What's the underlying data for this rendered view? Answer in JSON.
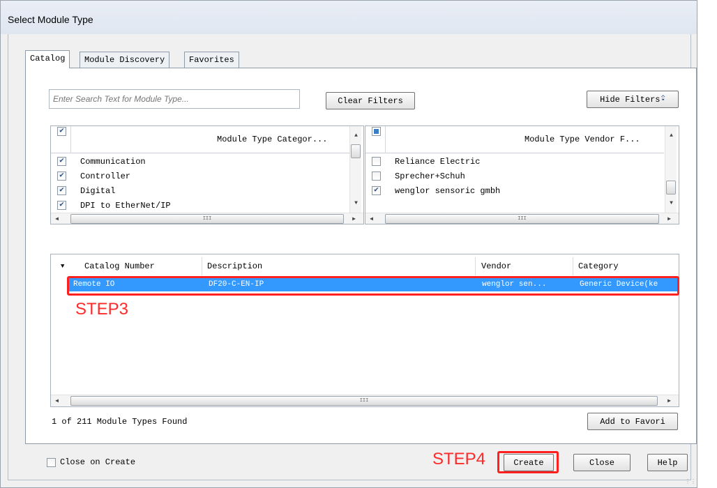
{
  "window": {
    "title": "Select Module Type"
  },
  "tabs": [
    {
      "label": "Catalog",
      "active": true
    },
    {
      "label": "Module Discovery",
      "active": false
    },
    {
      "label": "Favorites",
      "active": false
    }
  ],
  "search": {
    "placeholder": "Enter Search Text for Module Type..."
  },
  "buttons": {
    "clear_filters": "Clear Filters",
    "hide_filters": "Hide Filters",
    "add_to_favorites": "Add to Favori",
    "create": "Create",
    "close": "Close",
    "help": "Help"
  },
  "category_filter": {
    "header": "Module Type Categor...",
    "all_checked": true,
    "items": [
      {
        "label": "Communication",
        "checked": true
      },
      {
        "label": "Controller",
        "checked": true
      },
      {
        "label": "Digital",
        "checked": true
      },
      {
        "label": "DPI to EtherNet/IP",
        "checked": true
      }
    ]
  },
  "vendor_filter": {
    "header": "Module Type Vendor F...",
    "all_state": "partial",
    "items": [
      {
        "label": "Reliance Electric",
        "checked": false
      },
      {
        "label": "Sprecher+Schuh",
        "checked": false
      },
      {
        "label": "wenglor sensoric gmbh",
        "checked": true
      }
    ]
  },
  "results": {
    "columns": [
      "Catalog Number",
      "Description",
      "Vendor",
      "Category"
    ],
    "rows": [
      {
        "catalog_number": "Remote IO",
        "description": "DF20-C-EN-IP",
        "vendor": "wenglor sen...",
        "category": "Generic Device(ke",
        "selected": true
      }
    ],
    "status": "1  of 211 Module Types Found"
  },
  "annotations": {
    "step3": "STEP3",
    "step4": "STEP4",
    "color": "#ff2020"
  },
  "close_on_create": {
    "label": "Close on Create",
    "checked": false
  },
  "scroll_glyph": "III",
  "colors": {
    "selection": "#3399ff",
    "accent": "#3a7fc4"
  }
}
